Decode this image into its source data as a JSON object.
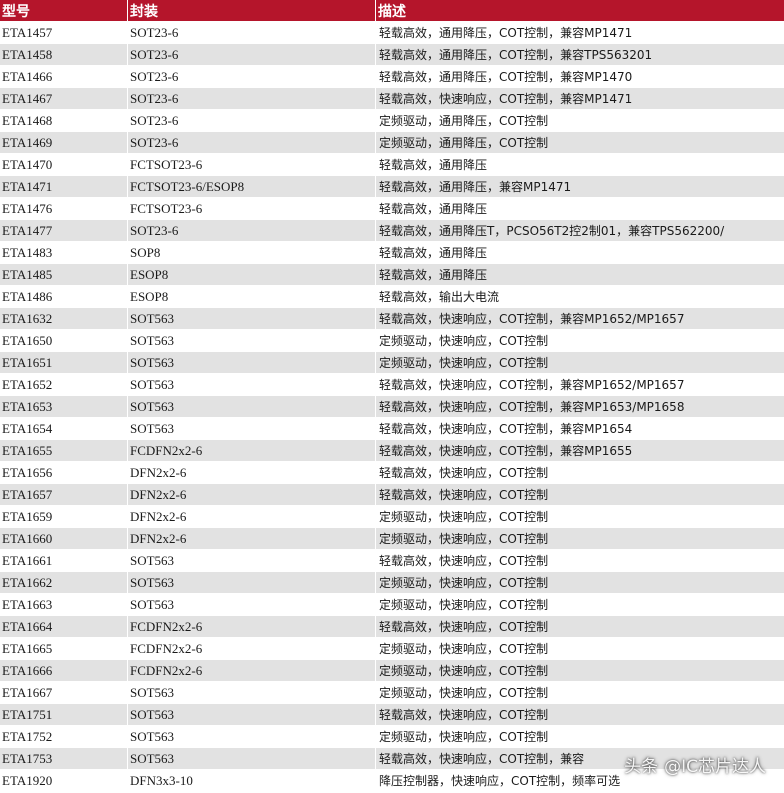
{
  "table": {
    "headers": [
      "型号",
      "封装",
      "描述"
    ],
    "rows": [
      [
        "ETA1457",
        "SOT23-6",
        "轻载高效，通用降压，COT控制，兼容MP1471"
      ],
      [
        "ETA1458",
        "SOT23-6",
        "轻载高效，通用降压，COT控制，兼容TPS563201"
      ],
      [
        "ETA1466",
        "SOT23-6",
        "轻载高效，通用降压，COT控制，兼容MP1470"
      ],
      [
        "ETA1467",
        "SOT23-6",
        "轻载高效，快速响应，COT控制，兼容MP1471"
      ],
      [
        "ETA1468",
        "SOT23-6",
        "定频驱动，通用降压，COT控制"
      ],
      [
        "ETA1469",
        "SOT23-6",
        "定频驱动，通用降压，COT控制"
      ],
      [
        "ETA1470",
        "FCTSOT23-6",
        "轻载高效，通用降压"
      ],
      [
        "ETA1471",
        "FCTSOT23-6/ESOP8",
        "轻载高效，通用降压，兼容MP1471"
      ],
      [
        "ETA1476",
        "FCTSOT23-6",
        "轻载高效，通用降压"
      ],
      [
        "ETA1477",
        "SOT23-6",
        "轻载高效，通用降压T，PCSO56T2控2制01，兼容TPS562200/"
      ],
      [
        "ETA1483",
        "SOP8",
        "轻载高效，通用降压"
      ],
      [
        "ETA1485",
        "ESOP8",
        "轻载高效，通用降压"
      ],
      [
        "ETA1486",
        "ESOP8",
        "轻载高效，输出大电流"
      ],
      [
        "ETA1632",
        "SOT563",
        "轻载高效，快速响应，COT控制，兼容MP1652/MP1657"
      ],
      [
        "ETA1650",
        "SOT563",
        "定频驱动，快速响应，COT控制"
      ],
      [
        "ETA1651",
        "SOT563",
        "定频驱动，快速响应，COT控制"
      ],
      [
        "ETA1652",
        "SOT563",
        "轻载高效，快速响应，COT控制，兼容MP1652/MP1657"
      ],
      [
        "ETA1653",
        "SOT563",
        "轻载高效，快速响应，COT控制，兼容MP1653/MP1658"
      ],
      [
        "ETA1654",
        "SOT563",
        "轻载高效，快速响应，COT控制，兼容MP1654"
      ],
      [
        "ETA1655",
        "FCDFN2x2-6",
        "轻载高效，快速响应，COT控制，兼容MP1655"
      ],
      [
        "ETA1656",
        "DFN2x2-6",
        "轻载高效，快速响应，COT控制"
      ],
      [
        "ETA1657",
        "DFN2x2-6",
        "轻载高效，快速响应，COT控制"
      ],
      [
        "ETA1659",
        "DFN2x2-6",
        "定频驱动，快速响应，COT控制"
      ],
      [
        "ETA1660",
        "DFN2x2-6",
        "定频驱动，快速响应，COT控制"
      ],
      [
        "ETA1661",
        "SOT563",
        "轻载高效，快速响应，COT控制"
      ],
      [
        "ETA1662",
        "SOT563",
        "定频驱动，快速响应，COT控制"
      ],
      [
        "ETA1663",
        "SOT563",
        "定频驱动，快速响应，COT控制"
      ],
      [
        "ETA1664",
        "FCDFN2x2-6",
        "轻载高效，快速响应，COT控制"
      ],
      [
        "ETA1665",
        "FCDFN2x2-6",
        "定频驱动，快速响应，COT控制"
      ],
      [
        "ETA1666",
        "FCDFN2x2-6",
        "定频驱动，快速响应，COT控制"
      ],
      [
        "ETA1667",
        "SOT563",
        "定频驱动，快速响应，COT控制"
      ],
      [
        "ETA1751",
        "SOT563",
        "轻载高效，快速响应，COT控制"
      ],
      [
        "ETA1752",
        "SOT563",
        "定频驱动，快速响应，COT控制"
      ],
      [
        "ETA1753",
        "SOT563",
        "轻载高效，快速响应，COT控制，兼容"
      ],
      [
        "ETA1920",
        "DFN3x3-10",
        "降压控制器，快速响应，COT控制，频率可选"
      ]
    ]
  },
  "watermark": {
    "source": "头条",
    "account": "@IC芯片达人"
  },
  "colors": {
    "header_bg": "#b5152b",
    "header_text": "#ffffff",
    "row_alt_bg": "#e2e2e2"
  }
}
